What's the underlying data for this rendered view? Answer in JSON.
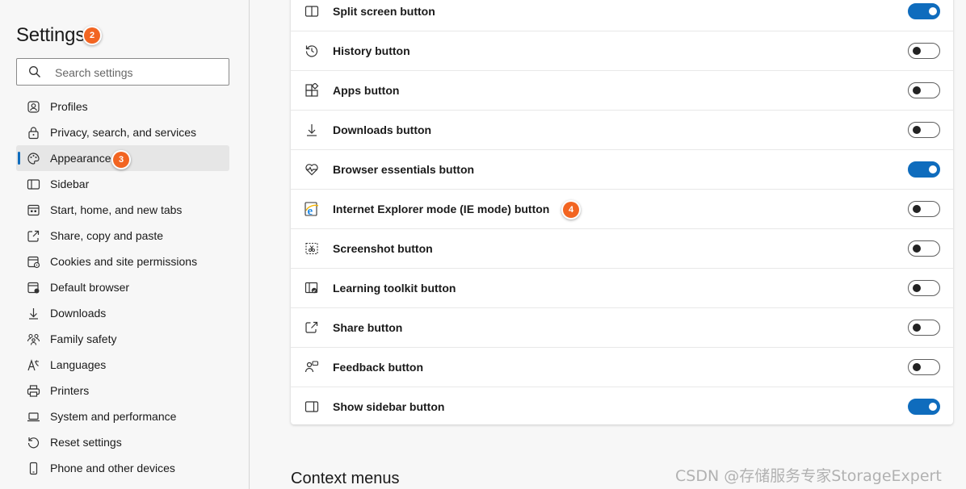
{
  "sidebar": {
    "title": "Settings",
    "search": {
      "placeholder": "Search settings",
      "icon": "search-icon"
    },
    "items": [
      {
        "label": "Profiles",
        "icon": "profile-icon"
      },
      {
        "label": "Privacy, search, and services",
        "icon": "lock-icon"
      },
      {
        "label": "Appearance",
        "icon": "palette-icon",
        "selected": true
      },
      {
        "label": "Sidebar",
        "icon": "sidebar-icon"
      },
      {
        "label": "Start, home, and new tabs",
        "icon": "home-tabs-icon"
      },
      {
        "label": "Share, copy and paste",
        "icon": "share-icon"
      },
      {
        "label": "Cookies and site permissions",
        "icon": "cookies-icon"
      },
      {
        "label": "Default browser",
        "icon": "browser-icon"
      },
      {
        "label": "Downloads",
        "icon": "download-icon"
      },
      {
        "label": "Family safety",
        "icon": "family-icon"
      },
      {
        "label": "Languages",
        "icon": "languages-icon"
      },
      {
        "label": "Printers",
        "icon": "printer-icon"
      },
      {
        "label": "System and performance",
        "icon": "laptop-icon"
      },
      {
        "label": "Reset settings",
        "icon": "reset-icon"
      },
      {
        "label": "Phone and other devices",
        "icon": "phone-icon"
      }
    ]
  },
  "main": {
    "buttons": [
      {
        "label": "Split screen button",
        "icon": "split-screen-icon",
        "on": true
      },
      {
        "label": "History button",
        "icon": "history-icon",
        "on": false
      },
      {
        "label": "Apps button",
        "icon": "apps-icon",
        "on": false
      },
      {
        "label": "Downloads button",
        "icon": "download-icon",
        "on": false
      },
      {
        "label": "Browser essentials button",
        "icon": "heartbeat-icon",
        "on": true
      },
      {
        "label": "Internet Explorer mode (IE mode) button",
        "icon": "ie-icon",
        "on": false
      },
      {
        "label": "Screenshot button",
        "icon": "screenshot-icon",
        "on": false
      },
      {
        "label": "Learning toolkit button",
        "icon": "learning-icon",
        "on": false
      },
      {
        "label": "Share button",
        "icon": "share-icon",
        "on": false
      },
      {
        "label": "Feedback button",
        "icon": "feedback-icon",
        "on": false
      },
      {
        "label": "Show sidebar button",
        "icon": "sidebar-icon",
        "on": true
      }
    ],
    "next_section_title": "Context menus"
  },
  "annotations": [
    "2",
    "3",
    "4"
  ],
  "watermark": "CSDN @存储服务专家StorageExpert",
  "colors": {
    "accent": "#0f6cbd",
    "badge": "#f26522"
  }
}
